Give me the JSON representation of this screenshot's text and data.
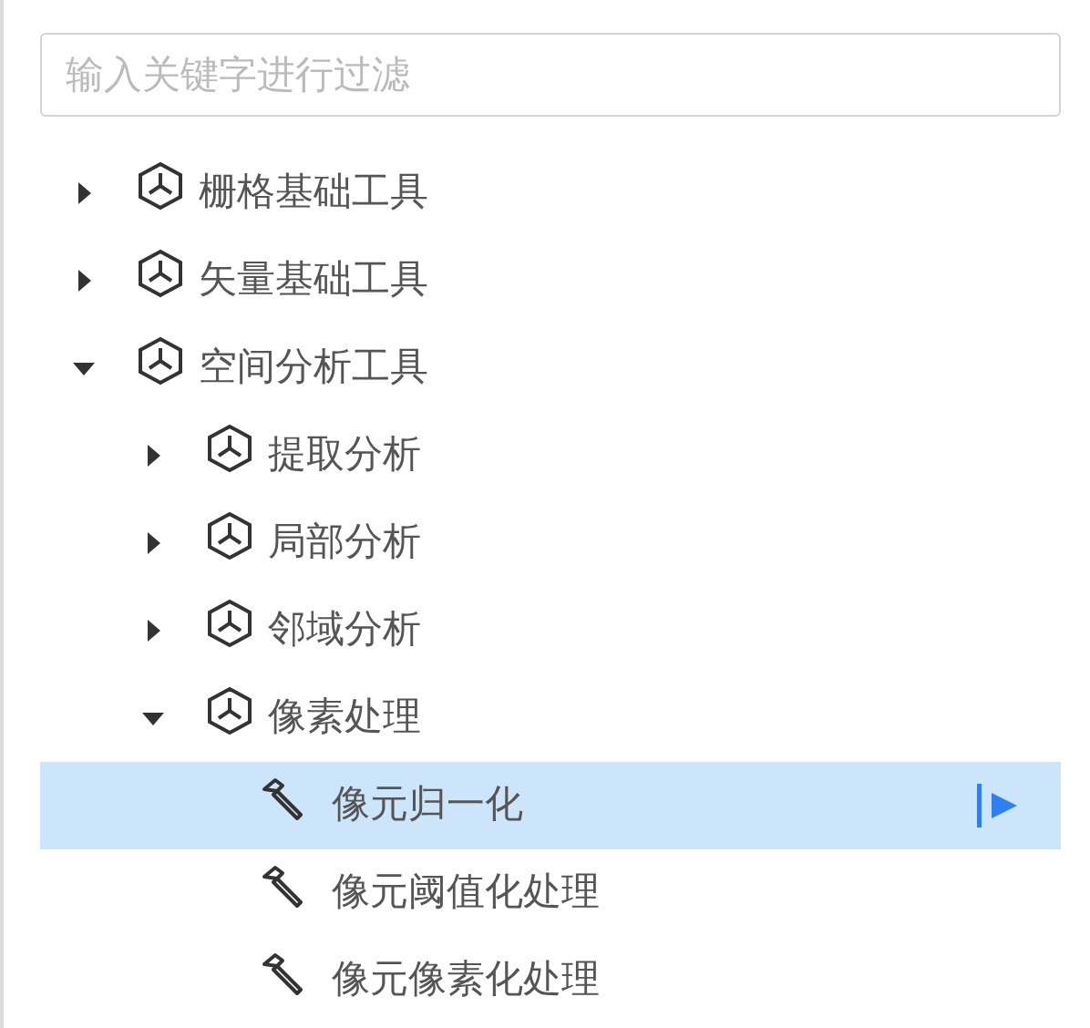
{
  "search": {
    "placeholder": "输入关键字进行过滤"
  },
  "tree": [
    {
      "kind": "folder",
      "label": "栅格基础工具",
      "expanded": false,
      "selected": false
    },
    {
      "kind": "folder",
      "label": "矢量基础工具",
      "expanded": false,
      "selected": false
    },
    {
      "kind": "folder",
      "label": "空间分析工具",
      "expanded": true,
      "selected": false,
      "children": [
        {
          "kind": "folder",
          "label": "提取分析",
          "expanded": false,
          "selected": false
        },
        {
          "kind": "folder",
          "label": "局部分析",
          "expanded": false,
          "selected": false
        },
        {
          "kind": "folder",
          "label": "邻域分析",
          "expanded": false,
          "selected": false
        },
        {
          "kind": "folder",
          "label": "像素处理",
          "expanded": true,
          "selected": false,
          "children": [
            {
              "kind": "tool",
              "label": "像元归一化",
              "selected": true
            },
            {
              "kind": "tool",
              "label": "像元阈值化处理",
              "selected": false
            },
            {
              "kind": "tool",
              "label": "像元像素化处理",
              "selected": false
            }
          ]
        }
      ]
    }
  ]
}
